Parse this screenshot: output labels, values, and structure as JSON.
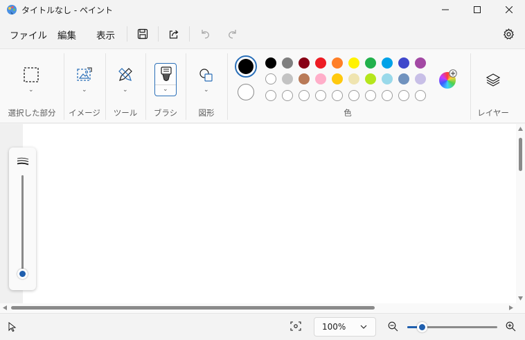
{
  "window": {
    "title": "タイトルなし - ペイント",
    "controls": [
      "minimize",
      "maximize",
      "close"
    ]
  },
  "menu": {
    "file": "ファイル",
    "edit": "編集",
    "view": "表示"
  },
  "ribbon": {
    "groups": {
      "selection": "選択した部分",
      "image": "イメージ",
      "tools": "ツール",
      "brushes": "ブラシ",
      "shapes": "図形",
      "colors": "色",
      "layers": "レイヤー"
    },
    "primary_color": "#000000",
    "secondary_color": "#ffffff",
    "palette_row1": [
      "#000000",
      "#7f7f7f",
      "#880015",
      "#ed1c24",
      "#ff7f27",
      "#fff200",
      "#22b14c",
      "#00a2e8",
      "#3f48cc",
      "#a349a4"
    ],
    "palette_row2": [
      "#ffffff",
      "#c3c3c3",
      "#b97a57",
      "#ffaec9",
      "#ffc90e",
      "#efe4b0",
      "#b5e61d",
      "#99d9ea",
      "#7092be",
      "#c8bfe7"
    ],
    "palette_row3_count": 10
  },
  "status": {
    "zoom": "100%",
    "zoom_slider_fraction": 0.16
  },
  "brush_size_fraction": 0.0
}
